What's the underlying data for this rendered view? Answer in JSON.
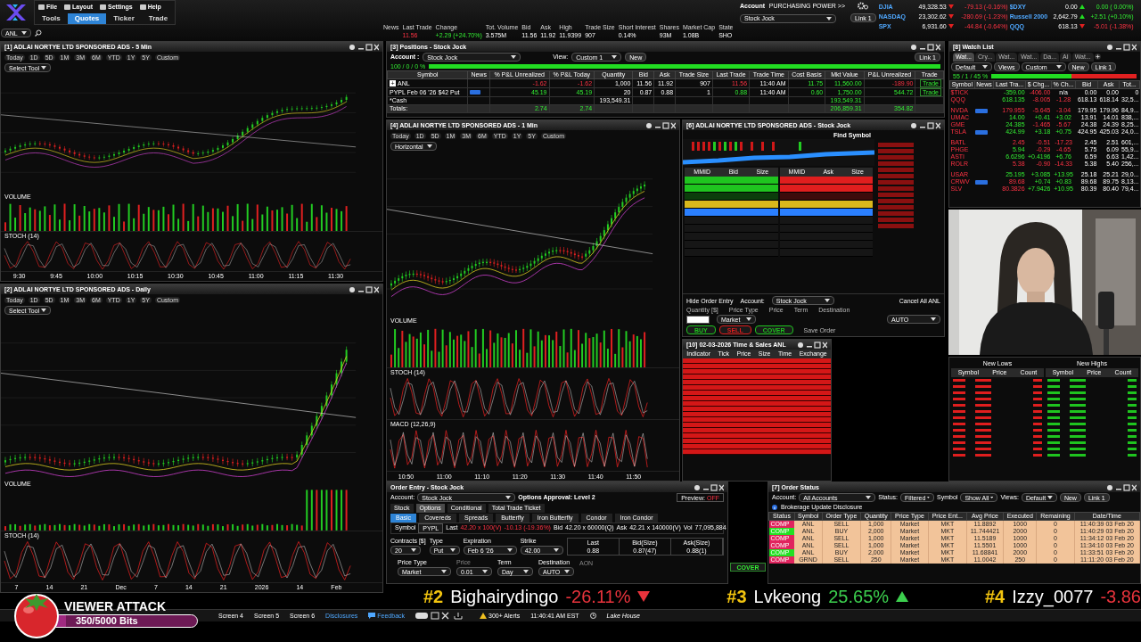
{
  "menu": {
    "items": [
      "File",
      "Layout",
      "Settings",
      "Help"
    ],
    "tabs": [
      {
        "label": "Tools",
        "selected": false
      },
      {
        "label": "Quotes",
        "selected": true
      },
      {
        "label": "Ticker",
        "selected": false
      },
      {
        "label": "Trade",
        "selected": false
      }
    ]
  },
  "symbol_field": {
    "value": "ANL"
  },
  "quote": [
    {
      "label": "News"
    },
    {
      "label": "Last Trade",
      "value": "11.56",
      "kind": "loss"
    },
    {
      "label": "Change",
      "value": "+2.29 (+24.70%)",
      "kind": "gain"
    },
    {
      "label": "Tot. Volume",
      "value": "3.575M",
      "kind": "plain"
    },
    {
      "label": "Bid",
      "value": "11.56",
      "kind": "plain"
    },
    {
      "label": "Ask",
      "value": "11.92",
      "kind": "plain"
    },
    {
      "label": "High",
      "value": "11.9399",
      "kind": "plain"
    },
    {
      "label": "Trade Size",
      "value": "907",
      "kind": "plain"
    },
    {
      "label": "Short Interest",
      "value": "0.14%",
      "kind": "plain"
    },
    {
      "label": "Shares",
      "value": "93M",
      "kind": "plain"
    },
    {
      "label": "Market Cap",
      "value": "1.08B",
      "kind": "plain"
    },
    {
      "label": "State",
      "value": "SHO",
      "kind": "plain"
    }
  ],
  "account": {
    "label": "Account",
    "value": "Stock Jock",
    "purchasing_power": "PURCHASING POWER >>",
    "link": "Link 1"
  },
  "indices": [
    {
      "name": "DJIA",
      "value": "49,328.53",
      "change": "-79.13 (-0.16%)",
      "up": false
    },
    {
      "name": "$DXY",
      "value": "0.00",
      "change": "0.00 ( 0.00%)",
      "up": true
    },
    {
      "name": "NASDAQ",
      "value": "23,302.62",
      "change": "-280.69 (-1.23%)",
      "up": false
    },
    {
      "name": "Russell 2000",
      "value": "2,642.79",
      "change": "+2.51 (+0.10%)",
      "up": true
    },
    {
      "name": "SPX",
      "value": "6,931.60",
      "change": "-44.84 (-0.64%)",
      "up": false
    },
    {
      "name": "QQQ",
      "value": "618.13",
      "change": "-5.01 (-1.38%)",
      "up": false
    }
  ],
  "charts": [
    {
      "title": "[1] ADLAI NORTYE LTD SPONSORED ADS - 5 Min",
      "select_tool": "Select Tool",
      "ranges": [
        "Today",
        "1D",
        "5D",
        "1M",
        "3M",
        "6M",
        "YTD",
        "1Y",
        "5Y",
        "Custom"
      ],
      "panes": [
        "VOLUME",
        "STOCH (14)"
      ],
      "x_labels": [
        "9:30",
        "9:45",
        "10:00",
        "10:15",
        "10:30",
        "10:45",
        "11:00",
        "11:15",
        "11:30"
      ]
    },
    {
      "title": "[2] ADLAI NORTYE LTD SPONSORED ADS - Daily",
      "select_tool": "Select Tool",
      "ranges": [
        "Today",
        "1D",
        "5D",
        "1M",
        "3M",
        "6M",
        "YTD",
        "1Y",
        "5Y",
        "Custom"
      ],
      "panes": [
        "VOLUME",
        "STOCH (14)"
      ],
      "x_labels": [
        "7",
        "14",
        "21",
        "Dec",
        "7",
        "14",
        "21",
        "2026",
        "14",
        "Feb"
      ]
    },
    {
      "title": "[4] ADLAI NORTYE LTD SPONSORED ADS - 1 Min",
      "select_tool": "Horizontal",
      "ranges": [
        "Today",
        "1D",
        "5D",
        "1M",
        "3M",
        "6M",
        "YTD",
        "1Y",
        "5Y",
        "Custom"
      ],
      "panes": [
        "VOLUME",
        "STOCH (14)",
        "MACD (12,26,9)"
      ],
      "x_labels": [
        "10:50",
        "11:00",
        "11:10",
        "11:20",
        "11:30",
        "11:40",
        "11:50"
      ]
    }
  ],
  "positions": {
    "title": "[3] Positions  - Stock Jock",
    "account_label": "Account :",
    "account": "Stock Jock",
    "view_label": "View:",
    "view": "Custom 1",
    "new_button": "New",
    "link": "Link 1",
    "ratio": "100 / 0 / 0 %",
    "level": 1,
    "columns": [
      "Symbol",
      "News",
      "% P&L Unrealized",
      "% P&L Today",
      "Quantity",
      "Bid",
      "Ask",
      "Trade Size",
      "Last Trade",
      "Trade Time",
      "Cost Basis",
      "Mkt Value",
      "P&L Unrealized",
      "Trade"
    ],
    "rows": [
      {
        "kind": "position",
        "expand": "+",
        "cells": [
          {
            "text": "ANL",
            "kind": "plain"
          },
          {
            "kind": "blank"
          },
          {
            "text": "-1.62",
            "kind": "loss"
          },
          {
            "text": "-1.62",
            "kind": "loss"
          },
          {
            "text": "1,000",
            "kind": "plain"
          },
          {
            "text": "11.56",
            "kind": "plain"
          },
          {
            "text": "11.92",
            "kind": "plain"
          },
          {
            "text": "907",
            "kind": "plain"
          },
          {
            "text": "11.56",
            "kind": "loss"
          },
          {
            "text": "11:40 AM",
            "kind": "plain"
          },
          {
            "text": "11.75",
            "kind": "gain"
          },
          {
            "text": "11,560.00",
            "kind": "gain"
          },
          {
            "text": "-189.90",
            "kind": "loss"
          },
          {
            "text": "Trade",
            "kind": "button"
          }
        ]
      },
      {
        "kind": "position",
        "cells": [
          {
            "text": "PYPL Feb 06 '26 $42 Put",
            "kind": "plain"
          },
          {
            "kind": "news"
          },
          {
            "text": "45.19",
            "kind": "gain"
          },
          {
            "text": "45.19",
            "kind": "gain"
          },
          {
            "text": "20",
            "kind": "plain"
          },
          {
            "text": "0.87",
            "kind": "plain"
          },
          {
            "text": "0.88",
            "kind": "plain"
          },
          {
            "text": "1",
            "kind": "plain"
          },
          {
            "text": "0.88",
            "kind": "gain"
          },
          {
            "text": "11:40 AM",
            "kind": "plain"
          },
          {
            "text": "0.60",
            "kind": "gain"
          },
          {
            "text": "1,750.00",
            "kind": "gain"
          },
          {
            "text": "544.72",
            "kind": "gain"
          },
          {
            "text": "Trade",
            "kind": "button"
          }
        ]
      },
      {
        "kind": "cash",
        "cells": [
          {
            "text": "*Cash",
            "kind": "plain"
          },
          {
            "kind": "blank"
          },
          {
            "kind": "blank"
          },
          {
            "kind": "blank"
          },
          {
            "text": "193,549.31",
            "kind": "plain"
          },
          {
            "kind": "blank"
          },
          {
            "kind": "blank"
          },
          {
            "kind": "blank"
          },
          {
            "kind": "blank"
          },
          {
            "kind": "blank"
          },
          {
            "kind": "blank"
          },
          {
            "text": "193,549.31",
            "kind": "gain"
          },
          {
            "kind": "blank"
          },
          {
            "kind": "blank"
          }
        ]
      },
      {
        "kind": "totals",
        "cells": [
          {
            "text": "Totals:",
            "kind": "plain"
          },
          {
            "kind": "blank"
          },
          {
            "text": "2.74",
            "kind": "gain"
          },
          {
            "text": "2.74",
            "kind": "gain"
          },
          {
            "kind": "blank"
          },
          {
            "kind": "blank"
          },
          {
            "kind": "blank"
          },
          {
            "kind": "blank"
          },
          {
            "kind": "blank"
          },
          {
            "kind": "blank"
          },
          {
            "kind": "blank"
          },
          {
            "text": "206,859.31",
            "kind": "gain"
          },
          {
            "text": "354.82",
            "kind": "gain"
          },
          {
            "kind": "blank"
          }
        ]
      }
    ]
  },
  "level2": {
    "title": "[6] ADLAI NORTYE LTD SPONSORED ADS - Stock Jock",
    "find": "Find Symbol",
    "headers": [
      "MMID",
      "Bid",
      "Size",
      "MMID",
      "Ask",
      "Size"
    ],
    "bid_rows": [
      {
        "color": "#1fc41f"
      },
      {
        "color": "#1fc41f"
      },
      {
        "color": "#0b3d0b"
      },
      {
        "color": "#d9b81c"
      },
      {
        "color": "#2a7fff"
      },
      {
        "color": "#161616"
      },
      {
        "color": "#161616"
      },
      {
        "color": "#161616"
      },
      {
        "color": "#161616"
      },
      {
        "color": "#161616"
      }
    ],
    "ask_rows": [
      {
        "color": "#e01e1e"
      },
      {
        "color": "#e01e1e"
      },
      {
        "color": "#3d0b0b"
      },
      {
        "color": "#d9b81c"
      },
      {
        "color": "#2a7fff"
      },
      {
        "color": "#161616"
      },
      {
        "color": "#161616"
      },
      {
        "color": "#161616"
      },
      {
        "color": "#161616"
      },
      {
        "color": "#161616"
      }
    ],
    "hide_order_entry": "Hide Order Entry",
    "account_label": "Account:",
    "account": "Stock Jock",
    "cancel_all": "Cancel All ANL",
    "labels": [
      "Quantity [$]",
      "Price Type",
      "Price",
      "Term",
      "Destination"
    ],
    "price_type": "Market",
    "destination": "AUTO",
    "buttons": [
      {
        "label": "BUY",
        "color": "#1fc41f"
      },
      {
        "label": "SELL",
        "color": "#e01e1e"
      },
      {
        "label": "COVER",
        "color": "#1fc41f"
      }
    ],
    "save_order": "Save Order"
  },
  "time_sales": {
    "title": "[10] 02-03-2026 Time & Sales ANL",
    "headers": [
      "Indicator",
      "Tick",
      "Price",
      "Size",
      "Time",
      "Exchange"
    ],
    "rows": [
      {
        "color": "#d41717"
      },
      {
        "color": "#d41717"
      },
      {
        "color": "#d41717"
      },
      {
        "color": "#d41717"
      },
      {
        "color": "#d41717"
      },
      {
        "color": "#d41717"
      },
      {
        "color": "#d41717"
      },
      {
        "color": "#d41717"
      },
      {
        "color": "#d41717"
      },
      {
        "color": "#d41717"
      },
      {
        "color": "#d41717"
      },
      {
        "color": "#d41717"
      },
      {
        "color": "#d41717"
      },
      {
        "color": "#d41717"
      },
      {
        "color": "#d41717"
      },
      {
        "color": "#d41717"
      },
      {
        "color": "#d41717"
      },
      {
        "color": "#d41717"
      }
    ]
  },
  "watchlist": {
    "title": "[8] Watch List",
    "tabs": [
      {
        "label": "Wat...",
        "selected": true
      },
      {
        "label": "Cry...",
        "selected": false
      },
      {
        "label": "Wat...",
        "selected": false
      },
      {
        "label": "Wat...",
        "selected": false
      },
      {
        "label": "Da...",
        "selected": false
      },
      {
        "label": "AI",
        "selected": false
      },
      {
        "label": "Wat...",
        "selected": false
      }
    ],
    "view_set": "Default",
    "views_label": "Views",
    "view": "Custom",
    "new_button": "New",
    "link": "Link 1",
    "ratio": "55 / 1 / 45 %",
    "level": 0.55,
    "columns": [
      "Symbol",
      "News",
      "Last Tra...",
      "$ Chg...",
      "% Ch...",
      "Bid",
      "Ask",
      "Tot..."
    ],
    "rows": [
      {
        "kind": "quote",
        "symbol": "$TICK",
        "news": false,
        "last": "-359.00",
        "last_up": true,
        "chg": "-406.00",
        "chg_up": false,
        "pct": "n/a",
        "bid": "0.00",
        "ask": "0.00",
        "vol": "0"
      },
      {
        "kind": "quote",
        "symbol": "QQQ",
        "news": false,
        "last": "618.135",
        "last_up": true,
        "chg": "-8.005",
        "chg_up": false,
        "pct": "-1.28",
        "pct_up": false,
        "bid": "618.13",
        "ask": "618.14",
        "vol": "32,5..."
      },
      {
        "kind": "spacer"
      },
      {
        "kind": "quote",
        "symbol": "NVDA",
        "news": true,
        "last": "179.955",
        "last_up": false,
        "chg": "-5.645",
        "chg_up": false,
        "pct": "-3.04",
        "pct_up": false,
        "bid": "179.95",
        "ask": "179.96",
        "vol": "84,9..."
      },
      {
        "kind": "quote",
        "symbol": "UMAC",
        "news": false,
        "last": "14.00",
        "last_up": true,
        "chg": "+0.41",
        "chg_up": true,
        "pct": "+3.02",
        "pct_up": true,
        "bid": "13.91",
        "ask": "14.01",
        "vol": "838,..."
      },
      {
        "kind": "quote",
        "symbol": "GME",
        "news": false,
        "last": "24.385",
        "last_up": true,
        "chg": "-1.465",
        "chg_up": false,
        "pct": "-5.67",
        "pct_up": false,
        "bid": "24.38",
        "ask": "24.39",
        "vol": "8,25..."
      },
      {
        "kind": "quote",
        "symbol": "TSLA",
        "news": true,
        "last": "424.99",
        "last_up": true,
        "chg": "+3.18",
        "chg_up": true,
        "pct": "+0.75",
        "pct_up": true,
        "bid": "424.95",
        "ask": "425.03",
        "vol": "24,0..."
      },
      {
        "kind": "spacer"
      },
      {
        "kind": "quote",
        "symbol": "BATL",
        "news": false,
        "last": "2.45",
        "last_up": false,
        "chg": "-0.51",
        "chg_up": false,
        "pct": "-17.23",
        "pct_up": false,
        "bid": "2.45",
        "ask": "2.51",
        "vol": "601,..."
      },
      {
        "kind": "quote",
        "symbol": "PHGE",
        "news": false,
        "last": "5.94",
        "last_up": true,
        "chg": "-0.29",
        "chg_up": false,
        "pct": "-4.65",
        "pct_up": false,
        "bid": "5.75",
        "ask": "6.09",
        "vol": "55,9..."
      },
      {
        "kind": "quote",
        "symbol": "ASTI",
        "news": false,
        "last": "6.6296",
        "last_up": true,
        "chg": "+0.4196",
        "chg_up": true,
        "pct": "+6.76",
        "pct_up": true,
        "bid": "6.59",
        "ask": "6.63",
        "vol": "1,42..."
      },
      {
        "kind": "quote",
        "symbol": "ROLR",
        "news": false,
        "last": "5.38",
        "last_up": false,
        "chg": "-0.90",
        "chg_up": false,
        "pct": "-14.33",
        "pct_up": false,
        "bid": "5.38",
        "ask": "5.40",
        "vol": "256,..."
      },
      {
        "kind": "spacer"
      },
      {
        "kind": "quote",
        "symbol": "USAR",
        "news": false,
        "last": "25.195",
        "last_up": true,
        "chg": "+3.085",
        "chg_up": true,
        "pct": "+13.95",
        "pct_up": true,
        "bid": "25.18",
        "ask": "25.21",
        "vol": "29,0..."
      },
      {
        "kind": "quote",
        "symbol": "CRWV",
        "news": true,
        "last": "89.68",
        "last_up": false,
        "chg": "+0.74",
        "chg_up": true,
        "pct": "+0.83",
        "pct_up": true,
        "bid": "89.68",
        "ask": "89.75",
        "vol": "8,13..."
      },
      {
        "kind": "quote",
        "symbol": "SLV",
        "news": false,
        "last": "80.3826",
        "last_up": false,
        "chg": "+7.9426",
        "chg_up": true,
        "pct": "+10.95",
        "pct_up": true,
        "bid": "80.39",
        "ask": "80.40",
        "vol": "79,4..."
      }
    ]
  },
  "movers": {
    "sections": [
      {
        "title": "New Lows",
        "color": "#e01e1e",
        "columns": [
          "Symbol",
          "Price",
          "Count"
        ]
      },
      {
        "title": "New Highs",
        "color": "#1fc41f",
        "columns": [
          "Symbol",
          "Price",
          "Count"
        ]
      }
    ]
  },
  "order_entry": {
    "title": "Order Entry - Stock Jock",
    "account_label": "Account:",
    "account": "Stock Jock",
    "approval": "Options Approval: Level 2",
    "preview_label": "Preview:",
    "preview": "OFF",
    "tabs": [
      {
        "label": "Stock",
        "selected": false
      },
      {
        "label": "Options",
        "selected": true
      },
      {
        "label": "Conditional",
        "selected": false
      },
      {
        "label": "Total Trade Ticket",
        "selected": false
      }
    ],
    "strategies": [
      {
        "label": "Basic",
        "selected": true
      },
      {
        "label": "Covereds",
        "selected": false
      },
      {
        "label": "Spreads",
        "selected": false
      },
      {
        "label": "Butterfly",
        "selected": false
      },
      {
        "label": "Iron Butterfly",
        "selected": false
      },
      {
        "label": "Condor",
        "selected": false
      },
      {
        "label": "Iron Condor",
        "selected": false
      }
    ],
    "symbol_label": "Symbol",
    "symbol": "PYPL",
    "last_label": "Last",
    "last": "42.20 x 100(V)",
    "change": "-10.13 (-19.36%)",
    "bid_label": "Bid",
    "bid": "42.20 x 60000(Q)",
    "ask_label": "Ask",
    "ask": "42.21 x 140000(V)",
    "vol_label": "Vol",
    "vol": "77,095,884",
    "fields": [
      {
        "label": "Contracts  [$]",
        "value": "20"
      },
      {
        "label": "Type",
        "value": "Put"
      },
      {
        "label": "Expiration",
        "value": "Feb 6 '26"
      },
      {
        "label": "Strike",
        "value": "42.00"
      }
    ],
    "quote": [
      {
        "label": "Last",
        "value": "0.88"
      },
      {
        "label": "Bid(Size)",
        "value": "0.87(47)"
      },
      {
        "label": "Ask(Size)",
        "value": "0.88(1)"
      }
    ],
    "bottom": [
      {
        "label": "Price Type",
        "value": "Market"
      },
      {
        "label": "Price",
        "value": "0.01"
      },
      {
        "label": "Term",
        "value": "Day"
      },
      {
        "label": "Destination",
        "value": "AUTO"
      }
    ],
    "aon": "AON",
    "cover": "COVER"
  },
  "order_status": {
    "title": "[7] Order Status",
    "account_label": "Account:",
    "account": "All Accounts",
    "status_label": "Status:",
    "status": "Filtered",
    "symbol_label": "Symbol",
    "symbol": "Show All",
    "views_label": "Views:",
    "views": "Default",
    "new_button": "New",
    "link": "Link 1",
    "disclosure": "Brokerage Update Disclosure",
    "columns": [
      "Status",
      "Symbol",
      "Order Type",
      "Quantity",
      "Price Type",
      "Price Ent...",
      "Avg Price",
      "Executed",
      "Remaining",
      "Date/Time"
    ],
    "rows": [
      {
        "color": "#e0245e",
        "cells": [
          "COMP",
          "ANL",
          "SELL",
          "1,000",
          "Market",
          "MKT",
          "11.8892",
          "1000",
          "0",
          "11:40:39 03 Feb 20"
        ]
      },
      {
        "color": "#22e022",
        "cells": [
          "COMP",
          "ANL",
          "BUY",
          "2,000",
          "Market",
          "MKT",
          "11.744421",
          "2000",
          "0",
          "11:40:29 03 Feb 20"
        ]
      },
      {
        "color": "#e0245e",
        "cells": [
          "COMP",
          "ANL",
          "SELL",
          "1,000",
          "Market",
          "MKT",
          "11.5189",
          "1000",
          "0",
          "11:34:12 03 Feb 20"
        ]
      },
      {
        "color": "#e0245e",
        "cells": [
          "COMP",
          "ANL",
          "SELL",
          "1,000",
          "Market",
          "MKT",
          "11.5501",
          "1000",
          "0",
          "11:34:10 03 Feb 20"
        ]
      },
      {
        "color": "#22e022",
        "cells": [
          "COMP",
          "ANL",
          "BUY",
          "2,000",
          "Market",
          "MKT",
          "11.68841",
          "2000",
          "0",
          "11:33:51 03 Feb 20"
        ]
      },
      {
        "color": "#e0245e",
        "cells": [
          "COMP",
          "GRND",
          "SELL",
          "250",
          "Market",
          "MKT",
          "11.0042",
          "250",
          "0",
          "11:11:20 03 Feb 20"
        ]
      }
    ]
  },
  "ticker": [
    {
      "rank": "#2",
      "name": "Bighairydingo",
      "change": "-26.11%",
      "up": false,
      "arrow": true
    },
    {
      "rank": "#3",
      "name": "Lvkeong",
      "change": "25.65%",
      "up": true,
      "arrow": true
    },
    {
      "rank": "#4",
      "name": "Izzy_0077",
      "change": "-3.86",
      "up": false,
      "arrow": false
    }
  ],
  "viewer_attack": {
    "title": "VIEWER ATTACK",
    "progress": "350/5000 Bits",
    "level": 0.07
  },
  "taskbar": {
    "screens": [
      "Screen 4",
      "Screen 5",
      "Screen 6"
    ],
    "disclosures": "Disclosures",
    "feedback": "Feedback",
    "alerts": "300+ Alerts",
    "time": "11:40:41 AM EST",
    "location": "Lake House"
  }
}
